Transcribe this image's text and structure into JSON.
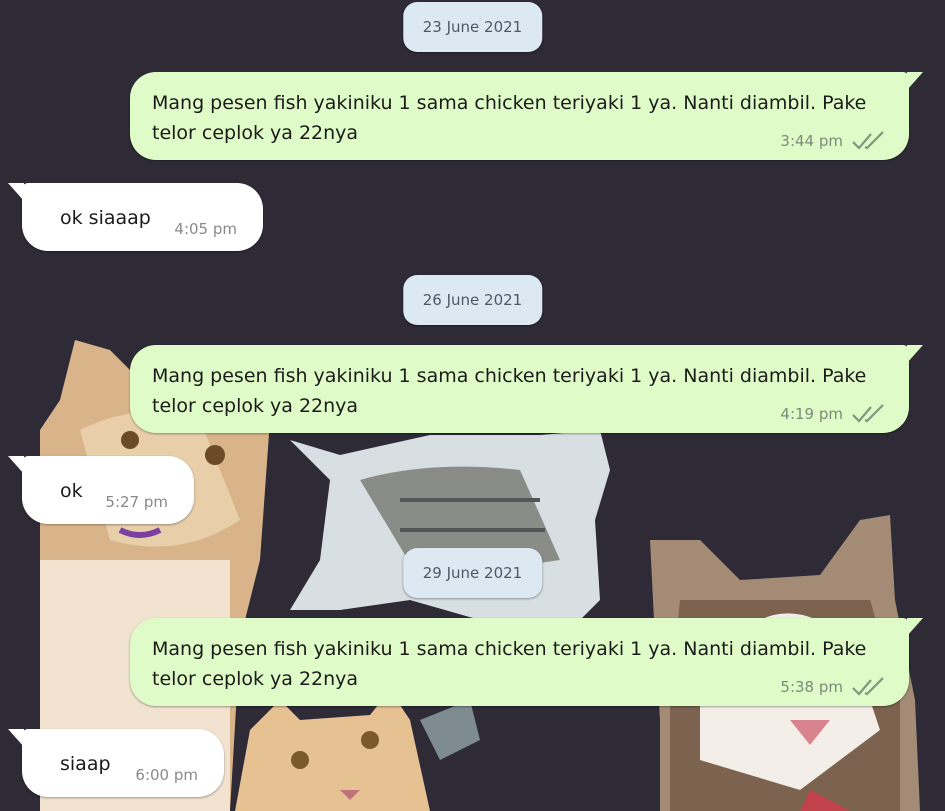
{
  "chat": {
    "dates": [
      "23 June 2021",
      "26 June 2021",
      "29 June 2021"
    ],
    "messages": [
      {
        "direction": "out",
        "text": "Mang pesen fish yakiniku 1 sama chicken teriyaki 1 ya. Nanti diambil. Pake telor ceplok ya 22nya",
        "time": "3:44 pm",
        "status": "read-double-tick"
      },
      {
        "direction": "in",
        "text": "ok siaaap",
        "time": "4:05 pm"
      },
      {
        "direction": "out",
        "text": "Mang pesen fish yakiniku 1 sama chicken teriyaki 1 ya. Nanti diambil. Pake telor ceplok ya 22nya",
        "time": "4:19 pm",
        "status": "read-double-tick"
      },
      {
        "direction": "in",
        "text": "ok",
        "time": "5:27 pm"
      },
      {
        "direction": "out",
        "text": "Mang pesen fish yakiniku 1 sama chicken teriyaki 1 ya. Nanti diambil. Pake telor ceplok ya 22nya",
        "time": "5:38 pm",
        "status": "read-double-tick"
      },
      {
        "direction": "in",
        "text": "siaap",
        "time": "6:00 pm"
      }
    ]
  },
  "colors": {
    "background": "#2e2b37",
    "outgoing_bubble": "#dffcc8",
    "incoming_bubble": "#ffffff",
    "date_pill": "#dce9f2"
  },
  "wallpaper": {
    "description_icon": "cat-photos-wallpaper"
  }
}
